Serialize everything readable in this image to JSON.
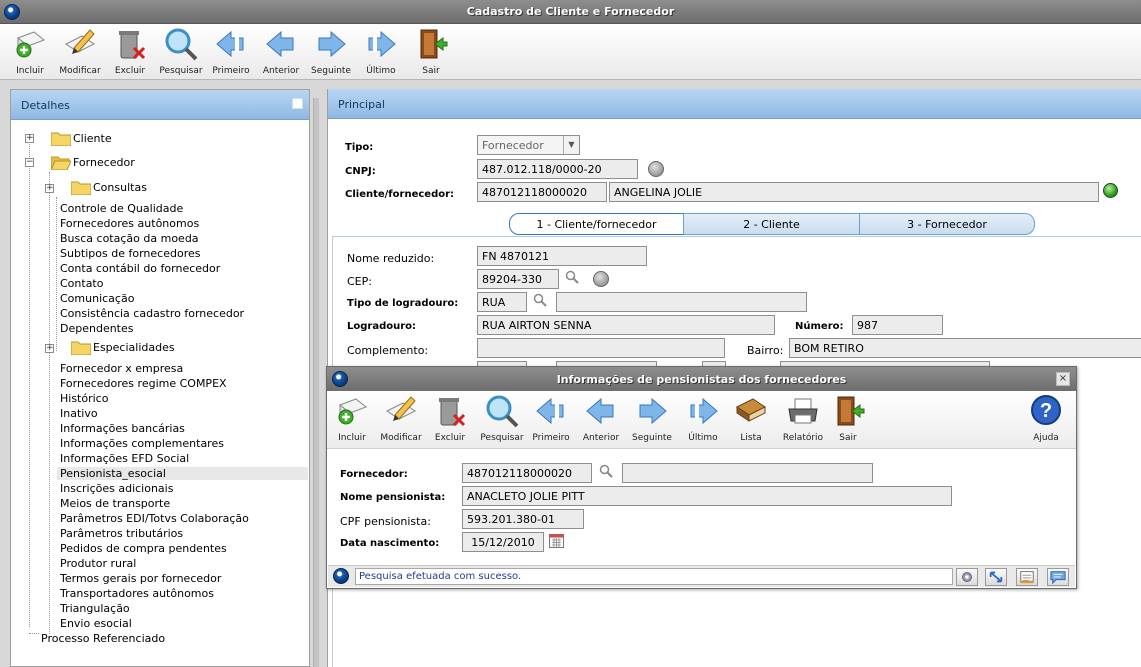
{
  "window": {
    "title": "Cadastro de Cliente e Fornecedor"
  },
  "toolbar": {
    "incluir": "Incluir",
    "modificar": "Modificar",
    "excluir": "Excluir",
    "pesquisar": "Pesquisar",
    "primeiro": "Primeiro",
    "anterior": "Anterior",
    "seguinte": "Seguinte",
    "ultimo": "Último",
    "sair": "Sair"
  },
  "left_panel": {
    "header": "Detalhes",
    "tree": {
      "cliente": "Cliente",
      "fornecedor": "Fornecedor",
      "consultas": "Consultas",
      "items_a": [
        "Controle de Qualidade",
        "Fornecedores autônomos",
        "Busca cotação da moeda",
        "Subtipos de fornecedores",
        "Conta contábil do fornecedor",
        "Contato",
        "Comunicação",
        "Consistência cadastro fornecedor",
        "Dependentes"
      ],
      "especialidades": "Especialidades",
      "items_b": [
        "Fornecedor x empresa",
        "Fornecedores regime COMPEX",
        "Histórico",
        "Inativo",
        "Informações bancárias",
        "Informações complementares",
        "Informações EFD Social",
        "Pensionista_esocial",
        "Inscrições adicionais",
        "Meios de transporte",
        "Parâmetros EDI/Totvs Colaboração",
        "Parâmetros tributários",
        "Pedidos de compra pendentes",
        "Produtor rural",
        "Termos gerais por fornecedor",
        "Transportadores autônomos",
        "Triangulação",
        "Envio esocial"
      ],
      "processo": "Processo Referenciado"
    }
  },
  "principal": {
    "header": "Principal",
    "tipo_label": "Tipo:",
    "tipo_value": "Fornecedor",
    "cnpj_label": "CNPJ:",
    "cnpj_value": "487.012.118/0000-20",
    "cf_label": "Cliente/fornecedor:",
    "cf_code": "487012118000020",
    "cf_name": "ANGELINA JOLIE",
    "tabs": [
      "1 - Cliente/fornecedor",
      "2 - Cliente",
      "3 - Fornecedor"
    ],
    "nome_reduzido_label": "Nome reduzido:",
    "nome_reduzido": "FN 4870121",
    "cep_label": "CEP:",
    "cep": "89204-330",
    "tipo_log_label": "Tipo de logradouro:",
    "tipo_log": "RUA",
    "tipo_log_desc": "",
    "logradouro_label": "Logradouro:",
    "logradouro": "RUA AIRTON SENNA",
    "numero_label": "Número:",
    "numero": "987",
    "complemento_label": "Complemento:",
    "complemento": "",
    "bairro_label": "Bairro:",
    "bairro": "BOM RETIRO"
  },
  "dialog": {
    "title": "Informações de pensionistas dos fornecedores",
    "toolbar": {
      "incluir": "Incluir",
      "modificar": "Modificar",
      "excluir": "Excluir",
      "pesquisar": "Pesquisar",
      "primeiro": "Primeiro",
      "anterior": "Anterior",
      "seguinte": "Seguinte",
      "ultimo": "Último",
      "lista": "Lista",
      "relatorio": "Relatório",
      "sair": "Sair",
      "ajuda": "Ajuda"
    },
    "fornecedor_label": "Fornecedor:",
    "fornecedor_code": "487012118000020",
    "fornecedor_desc": "",
    "nome_label": "Nome pensionista:",
    "nome": "ANACLETO JOLIE PITT",
    "cpf_label": "CPF pensionista:",
    "cpf": "593.201.380-01",
    "data_label": "Data nascimento:",
    "data": "15/12/2010",
    "status": "Pesquisa efetuada com sucesso."
  }
}
